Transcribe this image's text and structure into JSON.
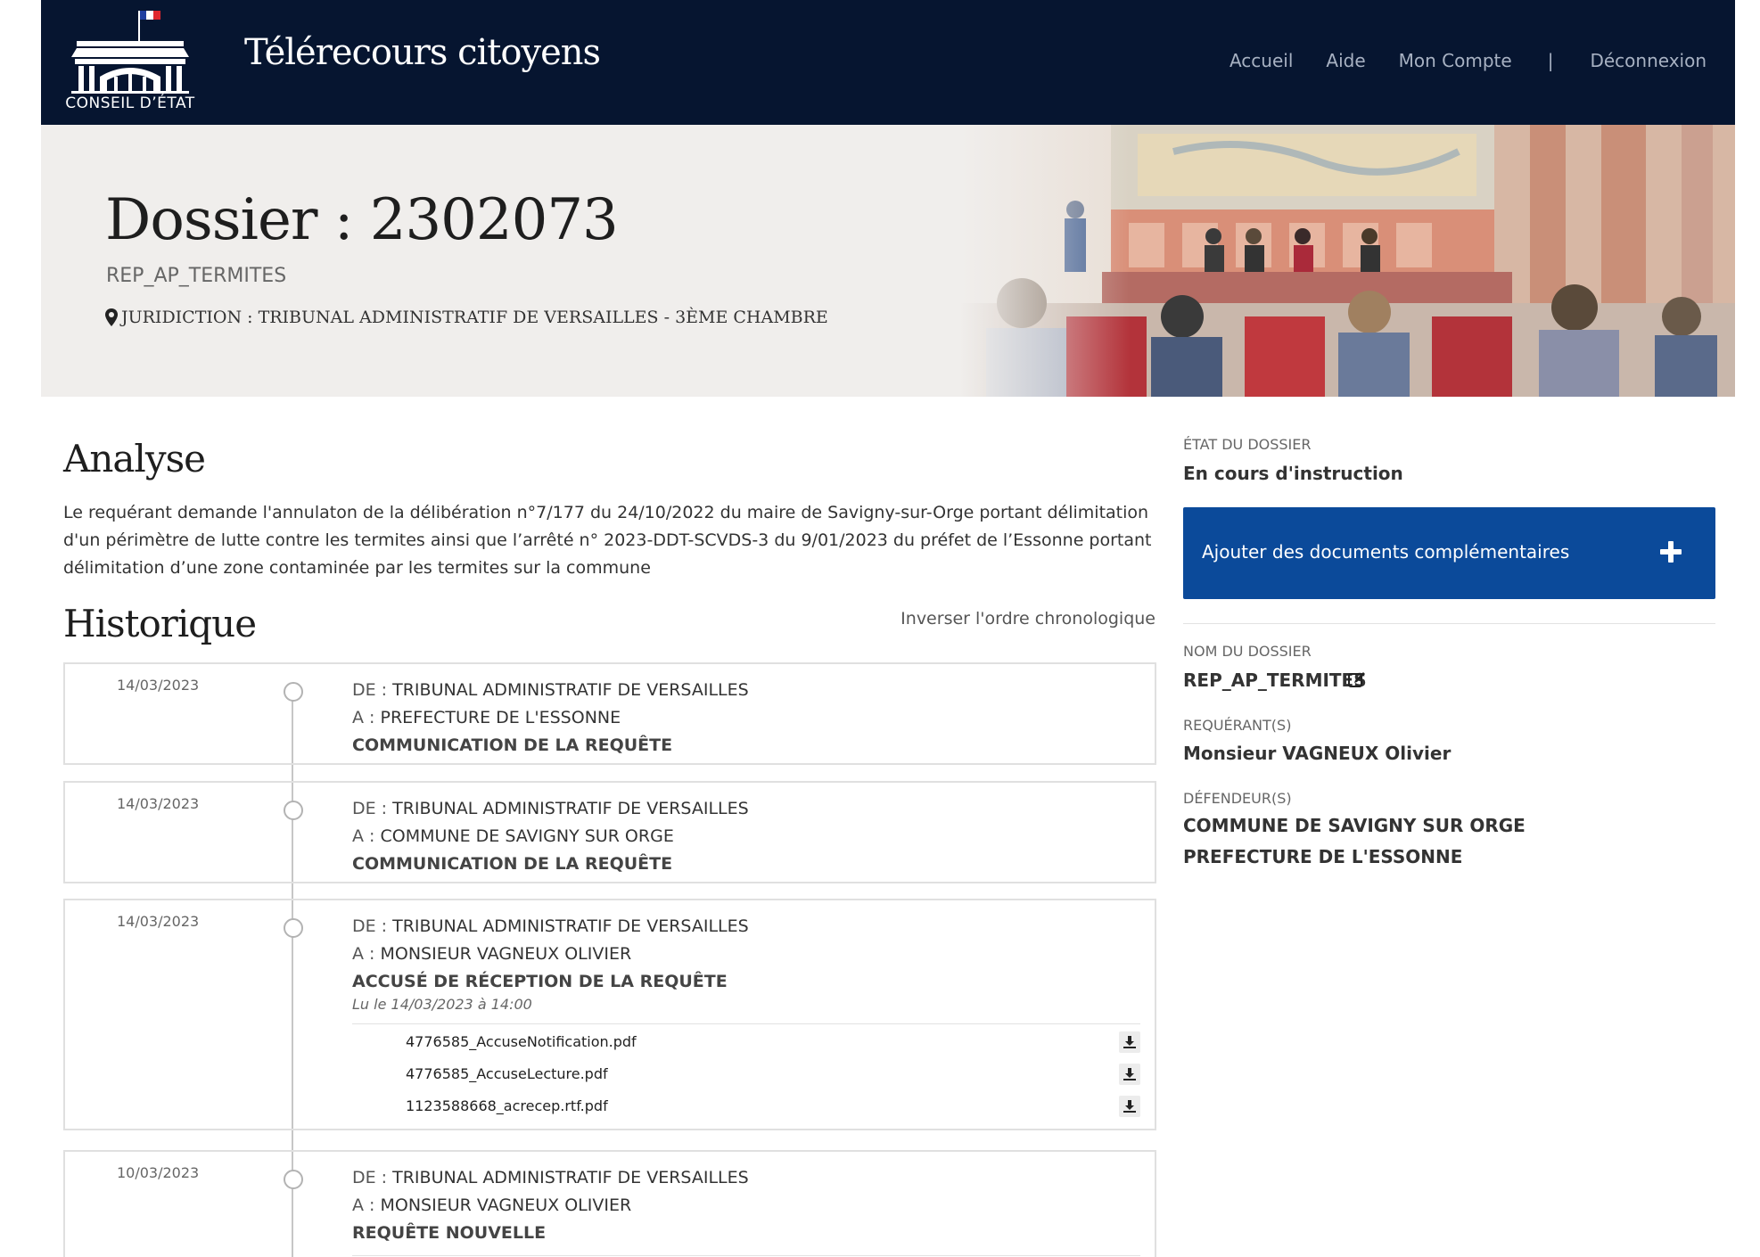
{
  "header": {
    "logo_text": "CONSEIL D’ÉTAT",
    "site_title": "Télérecours citoyens",
    "nav": {
      "home": "Accueil",
      "help": "Aide",
      "account": "Mon Compte",
      "separator": "|",
      "logout": "Déconnexion"
    }
  },
  "banner": {
    "title": "Dossier : 2302073",
    "subtitle": "REP_AP_TERMITES",
    "juridiction": "JURIDICTION : TRIBUNAL ADMINISTRATIF DE VERSAILLES - 3ÈME CHAMBRE"
  },
  "analysis": {
    "heading": "Analyse",
    "text": "Le requérant demande l'annulaton de la délibération n°7/177 du 24/10/2022 du maire de Savigny-sur-Orge portant délimitation d'un périmètre de lutte contre les termites ainsi que l’arrêté n° 2023-DDT-SCVDS-3 du 9/01/2023 du préfet de l’Essonne portant délimitation d’une zone contaminée par les termites sur la commune"
  },
  "history": {
    "heading": "Historique",
    "reverse_label": "Inverser l'ordre chronologique",
    "events": [
      {
        "date": "14/03/2023",
        "from_prefix": "DE :",
        "from": "TRIBUNAL ADMINISTRATIF DE VERSAILLES",
        "to_prefix": "A :",
        "to": "PREFECTURE DE L'ESSONNE",
        "subject": "COMMUNICATION DE LA REQUÊTE"
      },
      {
        "date": "14/03/2023",
        "from_prefix": "DE :",
        "from": "TRIBUNAL ADMINISTRATIF DE VERSAILLES",
        "to_prefix": "A :",
        "to": "COMMUNE DE SAVIGNY SUR ORGE",
        "subject": "COMMUNICATION DE LA REQUÊTE"
      },
      {
        "date": "14/03/2023",
        "from_prefix": "DE :",
        "from": "TRIBUNAL ADMINISTRATIF DE VERSAILLES",
        "to_prefix": "A :",
        "to": "MONSIEUR VAGNEUX OLIVIER",
        "subject": "ACCUSÉ DE RÉCEPTION DE LA REQUÊTE",
        "read": "Lu le 14/03/2023 à 14:00",
        "files": [
          "4776585_AccuseNotification.pdf",
          "4776585_AccuseLecture.pdf",
          "1123588668_acrecep.rtf.pdf"
        ]
      },
      {
        "date": "10/03/2023",
        "from_prefix": "DE :",
        "from": "TRIBUNAL ADMINISTRATIF DE VERSAILLES",
        "to_prefix": "A :",
        "to": "MONSIEUR VAGNEUX OLIVIER",
        "subject": "REQUÊTE NOUVELLE"
      }
    ]
  },
  "sidebar": {
    "status_label": "ÉTAT DU DOSSIER",
    "status_value": "En cours d'instruction",
    "add_docs_label": "Ajouter des documents complémentaires",
    "name_label": "NOM DU DOSSIER",
    "name_value": "REP_AP_TERMITES",
    "applicant_label": "REQUÉRANT(S)",
    "applicant_value": "Monsieur VAGNEUX Olivier",
    "defendants_label": "DÉFENDEUR(S)",
    "defendants": [
      "COMMUNE DE SAVIGNY SUR ORGE",
      "PREFECTURE DE L'ESSONNE"
    ]
  },
  "colors": {
    "navbar": "#061530",
    "banner_bg": "#f0eeec",
    "primary_button": "#0b4a9a",
    "flag_blue": "#1f3fa0",
    "flag_red": "#e0282e"
  },
  "icons": {
    "logo": "conseil-detat-building-logo",
    "location": "map-marker-icon",
    "add": "plus-icon",
    "download": "download-icon",
    "edit": "edit-icon"
  }
}
